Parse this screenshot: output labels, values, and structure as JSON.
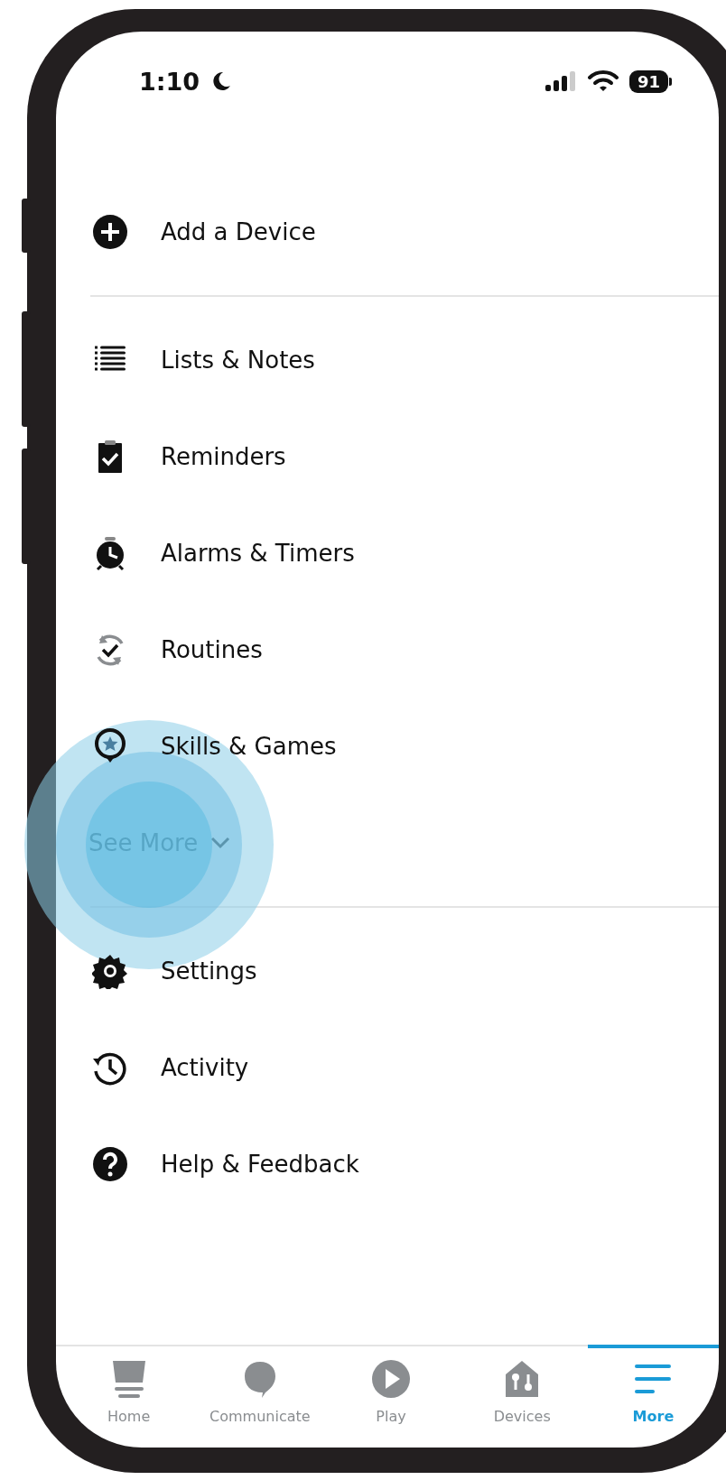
{
  "status_bar": {
    "time": "1:10",
    "battery": "91"
  },
  "menu_sections": [
    {
      "items": [
        {
          "label": "Add a Device"
        }
      ]
    },
    {
      "items": [
        {
          "label": "Lists & Notes"
        },
        {
          "label": "Reminders"
        },
        {
          "label": "Alarms & Timers"
        },
        {
          "label": "Routines"
        },
        {
          "label": "Skills & Games"
        }
      ],
      "see_more": {
        "label": "See More",
        "expanded": false
      }
    },
    {
      "items": [
        {
          "label": "Settings"
        },
        {
          "label": "Activity"
        },
        {
          "label": "Help & Feedback"
        }
      ]
    }
  ],
  "tabs": [
    {
      "label": "Home",
      "selected": false
    },
    {
      "label": "Communicate",
      "selected": false
    },
    {
      "label": "Play",
      "selected": false
    },
    {
      "label": "Devices",
      "selected": false
    },
    {
      "label": "More",
      "selected": true
    }
  ]
}
